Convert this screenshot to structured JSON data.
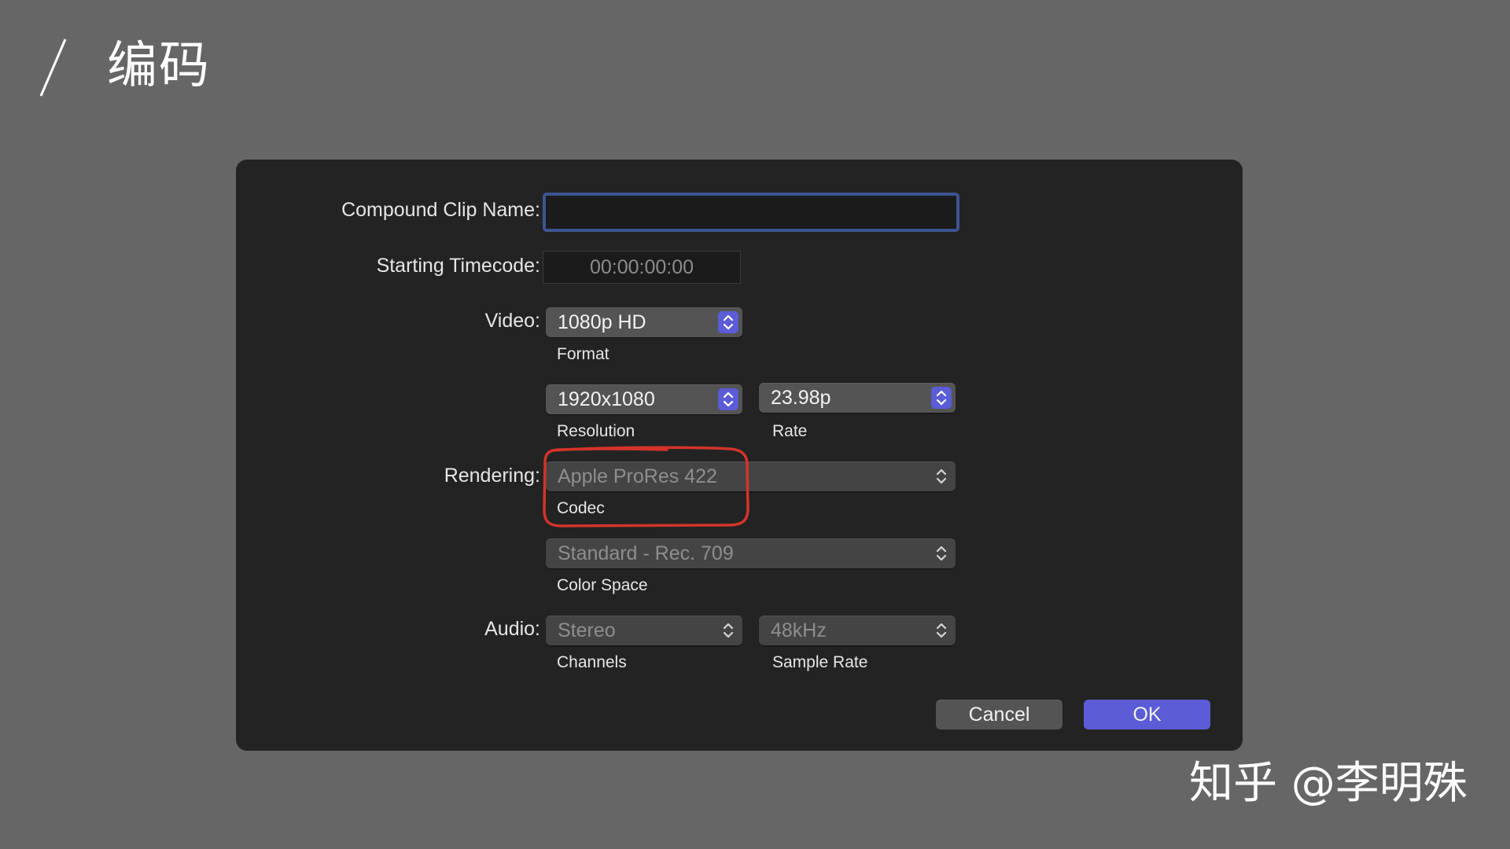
{
  "slide": {
    "title": "编码",
    "watermark": "知乎 @李明殊"
  },
  "dialog": {
    "compound_clip_name": {
      "label": "Compound Clip Name:",
      "value": ""
    },
    "starting_timecode": {
      "label": "Starting Timecode:",
      "value": "00:00:00:00"
    },
    "video": {
      "label": "Video:",
      "format": {
        "value": "1080p HD",
        "caption": "Format"
      },
      "resolution": {
        "value": "1920x1080",
        "caption": "Resolution"
      },
      "rate": {
        "value": "23.98p",
        "caption": "Rate"
      }
    },
    "rendering": {
      "label": "Rendering:",
      "codec": {
        "value": "Apple ProRes 422",
        "caption": "Codec"
      },
      "color_space": {
        "value": "Standard - Rec. 709",
        "caption": "Color Space"
      }
    },
    "audio": {
      "label": "Audio:",
      "channels": {
        "value": "Stereo",
        "caption": "Channels"
      },
      "sample_rate": {
        "value": "48kHz",
        "caption": "Sample Rate"
      }
    },
    "buttons": {
      "cancel": "Cancel",
      "ok": "OK"
    }
  },
  "colors": {
    "background": "#666666",
    "dialog": "#232323",
    "accent": "#5b5cd6",
    "annotation": "#d3342a"
  },
  "icons": {
    "stepper": "up-down-chevron-icon"
  }
}
